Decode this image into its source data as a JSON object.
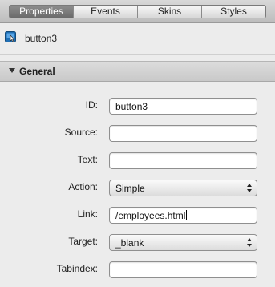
{
  "tabs": [
    {
      "label": "Properties",
      "active": true
    },
    {
      "label": "Events",
      "active": false
    },
    {
      "label": "Skins",
      "active": false
    },
    {
      "label": "Styles",
      "active": false
    }
  ],
  "component": {
    "name": "button3",
    "icon": "button-component-icon"
  },
  "section": {
    "title": "General",
    "expanded": true
  },
  "fields": {
    "id": {
      "label": "ID:",
      "value": "button3"
    },
    "source": {
      "label": "Source:",
      "value": ""
    },
    "text": {
      "label": "Text:",
      "value": ""
    },
    "action": {
      "label": "Action:",
      "value": "Simple"
    },
    "link": {
      "label": "Link:",
      "value": "/employees.html"
    },
    "target": {
      "label": "Target:",
      "value": "_blank"
    },
    "tabindex": {
      "label": "Tabindex:",
      "value": ""
    }
  },
  "colors": {
    "active_tab_bg": "#777777",
    "accent_icon": "#1f6fb5"
  }
}
